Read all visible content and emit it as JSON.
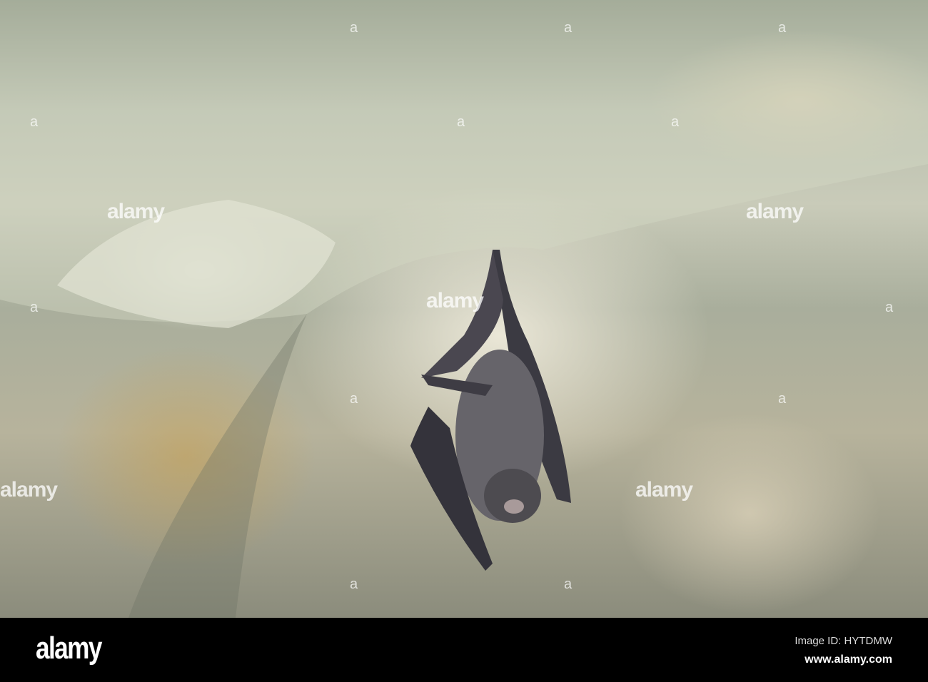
{
  "watermark": {
    "text": "alamy",
    "icon": "a"
  },
  "footer": {
    "logo": "alamy",
    "image_id": "Image ID: HYTDMW",
    "website": "www.alamy.com"
  }
}
